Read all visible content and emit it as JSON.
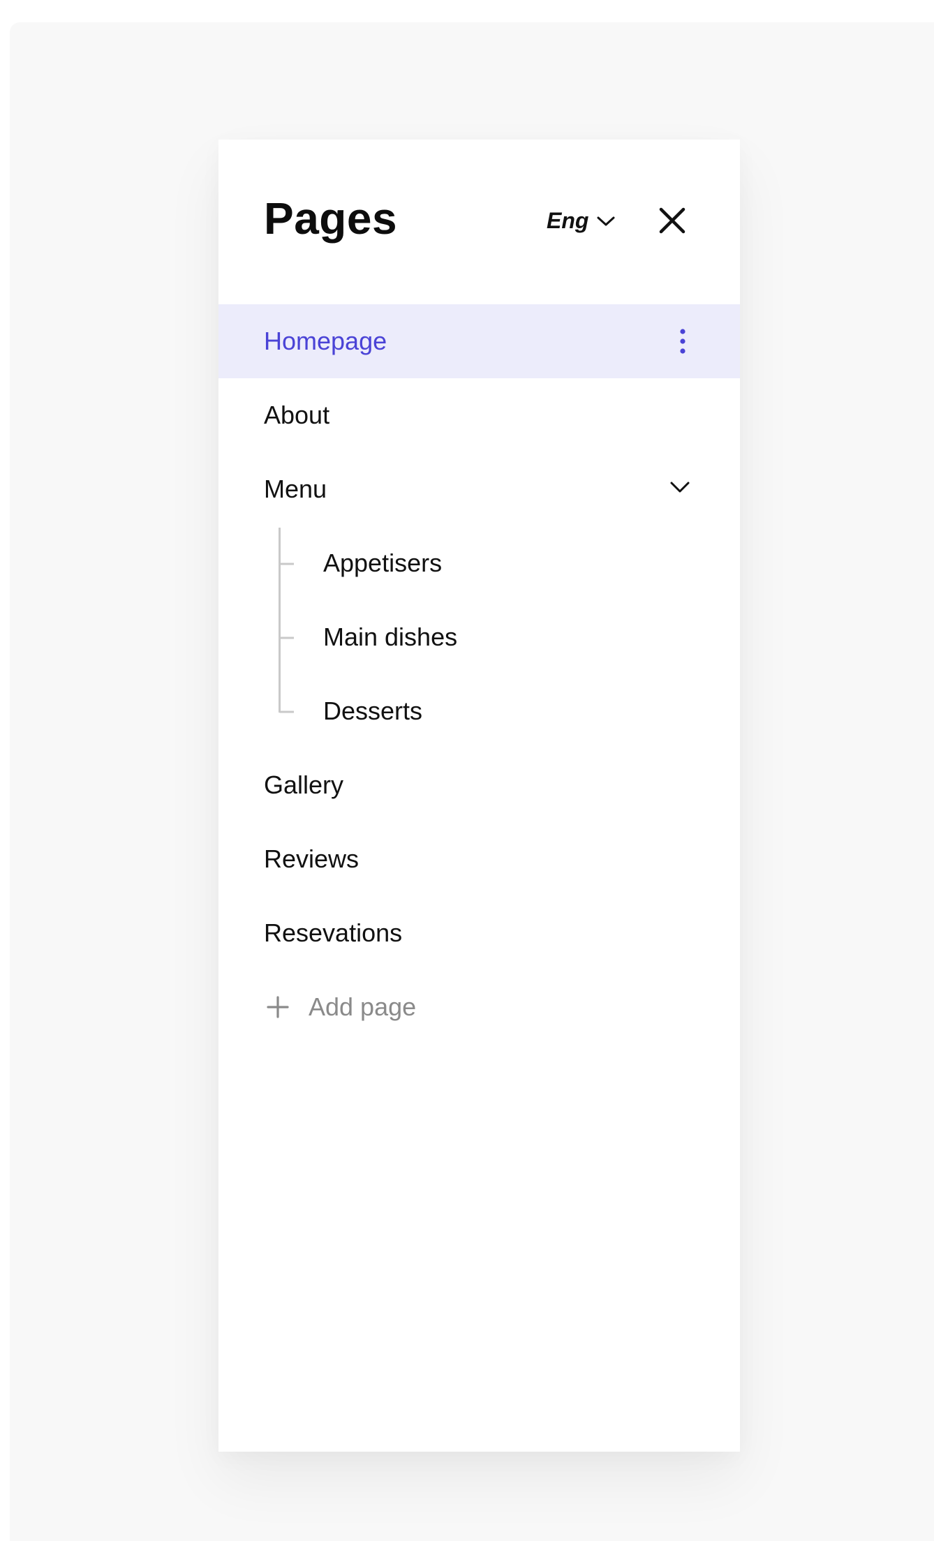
{
  "panel": {
    "title": "Pages",
    "language": "Eng",
    "icons": {
      "language_dropdown": "chevron-down-icon",
      "close": "close-icon"
    }
  },
  "pages": [
    {
      "label": "Homepage",
      "active": true,
      "icon": "more-vertical-icon"
    },
    {
      "label": "About"
    },
    {
      "label": "Menu",
      "icon": "chevron-down-icon",
      "expanded": true,
      "children": [
        {
          "label": "Appetisers"
        },
        {
          "label": "Main dishes"
        },
        {
          "label": "Desserts"
        }
      ]
    },
    {
      "label": "Gallery"
    },
    {
      "label": "Reviews"
    },
    {
      "label": "Resevations"
    }
  ],
  "add_page": {
    "label": "Add page",
    "icon": "plus-icon"
  },
  "colors": {
    "accent": "#4a43d6",
    "active_bg": "#ececfb",
    "text": "#111111",
    "muted": "#8a8a8a",
    "backdrop": "#f8f8f8"
  }
}
